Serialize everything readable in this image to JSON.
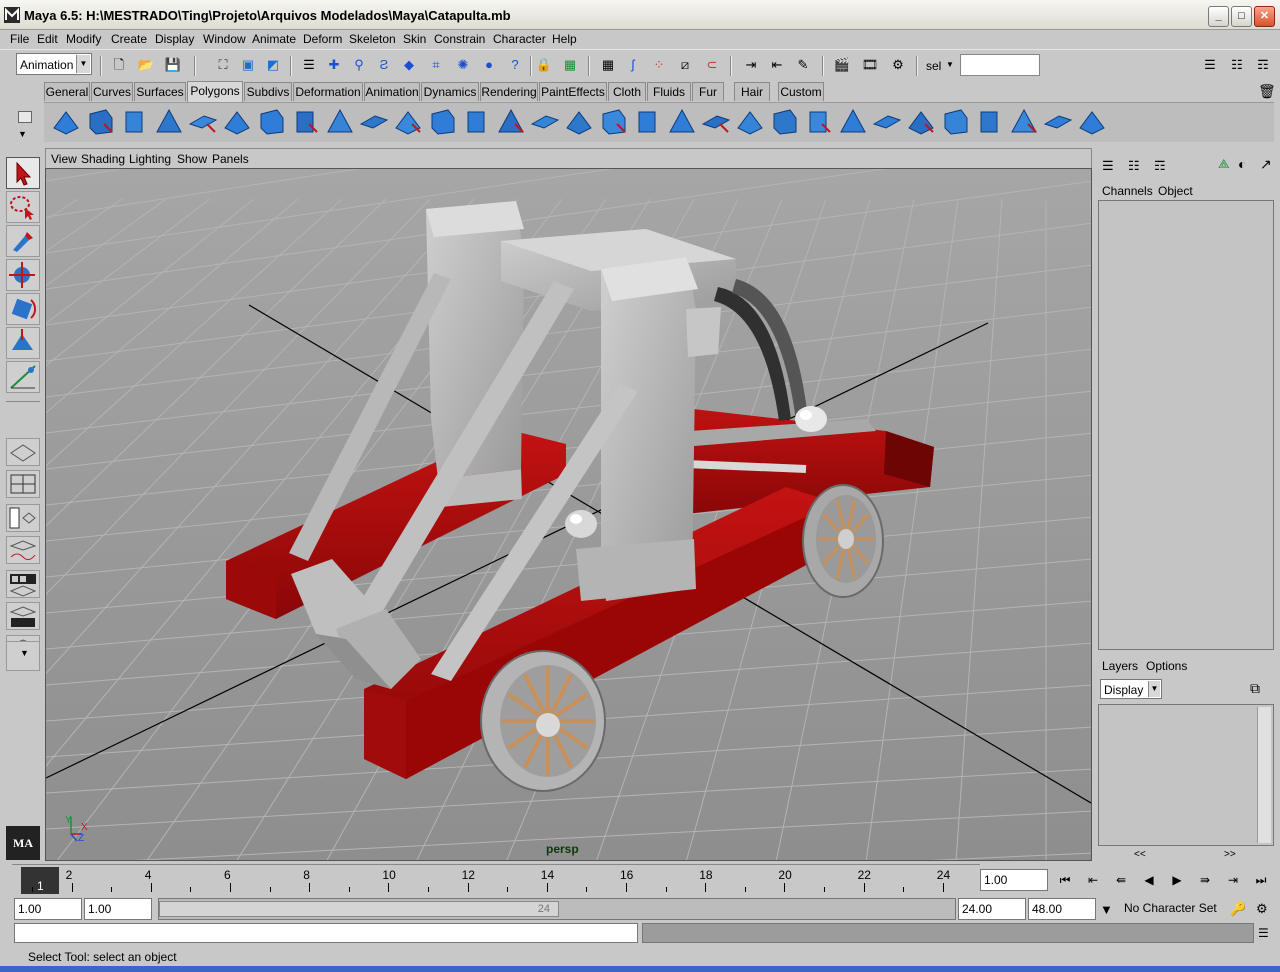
{
  "window": {
    "title": "Maya 6.5: H:\\MESTRADO\\Ting\\Projeto\\Arquivos Modelados\\Maya\\Catapulta.mb",
    "controls": [
      "minimize-icon",
      "maximize-icon",
      "close-icon"
    ]
  },
  "menu": [
    "File",
    "Edit",
    "Modify",
    "Create",
    "Display",
    "Window",
    "Animate",
    "Deform",
    "Skeleton",
    "Skin",
    "Constrain",
    "Character",
    "Help"
  ],
  "status_line": {
    "mode": "Animation",
    "selection_label": "sel",
    "selection_input": ""
  },
  "shelf": {
    "tabs": [
      "General",
      "Curves",
      "Surfaces",
      "Polygons",
      "Subdivs",
      "Deformation",
      "Animation",
      "Dynamics",
      "Rendering",
      "PaintEffects",
      "Cloth",
      "Fluids",
      "Fur",
      "Hair",
      "Custom"
    ],
    "active_tab": "Polygons"
  },
  "panel_menu": [
    "View",
    "Shading",
    "Lighting",
    "Show",
    "Panels"
  ],
  "viewport": {
    "camera": "persp",
    "axis_labels": {
      "x": "X",
      "y": "Y",
      "z": "Z"
    },
    "colors": {
      "frame_red": "#b00c0c",
      "frame_red_dark": "#7a0606",
      "wood_gray": "#bcbcbc",
      "spoke": "#c8905a"
    }
  },
  "channel_box": {
    "tabs": [
      "Channels",
      "Object"
    ]
  },
  "layers": {
    "tabs": [
      "Layers",
      "Options"
    ],
    "display": "Display",
    "nav_left": "<<",
    "nav_right": ">>"
  },
  "timeline": {
    "current_frame": "1",
    "labels": [
      "2",
      "4",
      "6",
      "8",
      "10",
      "12",
      "14",
      "16",
      "18",
      "20",
      "22",
      "24"
    ],
    "current_time": "1.00",
    "range_start": "1.00",
    "playback_start": "1.00",
    "range_end_label": "24",
    "playback_end": "24.00",
    "range_end": "48.00",
    "character_set": "No Character Set"
  },
  "help_line": "Select Tool: select an object"
}
